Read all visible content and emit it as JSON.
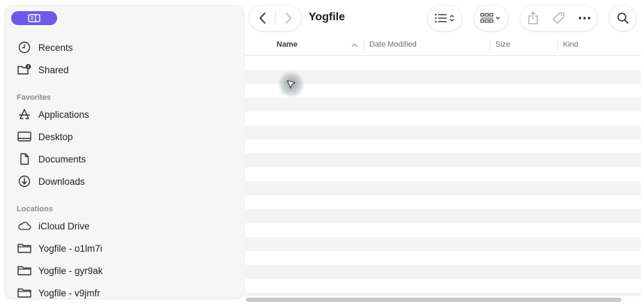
{
  "toolbar": {
    "title": "Yogfile"
  },
  "sidebar": {
    "items_top": [
      {
        "label": "Recents",
        "icon": "clock-icon"
      },
      {
        "label": "Shared",
        "icon": "shared-folder-icon"
      }
    ],
    "favorites_header": "Favorites",
    "favorites": [
      {
        "label": "Applications",
        "icon": "applications-icon"
      },
      {
        "label": "Desktop",
        "icon": "desktop-icon"
      },
      {
        "label": "Documents",
        "icon": "document-icon"
      },
      {
        "label": "Downloads",
        "icon": "download-icon"
      }
    ],
    "locations_header": "Locations",
    "locations": [
      {
        "label": "iCloud Drive",
        "icon": "cloud-icon"
      },
      {
        "label": "Yogfile - o1lm7i",
        "icon": "folder-icon"
      },
      {
        "label": "Yogfile - gyr9ak",
        "icon": "folder-icon"
      },
      {
        "label": "Yogfile - v9jmfr",
        "icon": "folder-icon"
      }
    ]
  },
  "columns": {
    "name": "Name",
    "date_modified": "Date Modified",
    "size": "Size",
    "kind": "Kind"
  },
  "colors": {
    "accent": "#6b5ce7",
    "row_alt": "#f4f4f4",
    "sidebar_bg": "#f6f6f6"
  }
}
